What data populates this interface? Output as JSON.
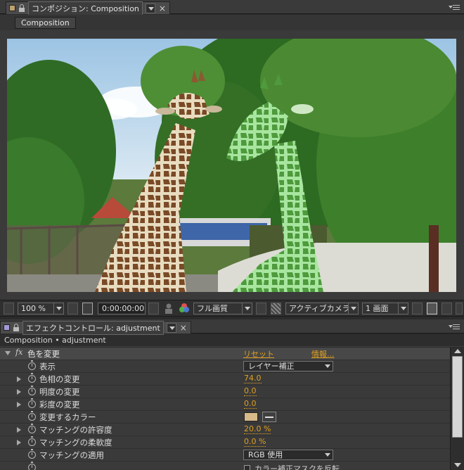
{
  "comp_panel": {
    "tab_title": "コンポジション: Composition",
    "comp_button": "Composition"
  },
  "viewer_toolbar": {
    "zoom": "100 %",
    "timecode": "0:00:00:00",
    "resolution": "フル画質",
    "camera": "アクティブカメラ",
    "views": "1 画面"
  },
  "effects_panel": {
    "tab_title": "エフェクトコントロール: adjustment",
    "breadcrumb": "Composition • adjustment",
    "effect": {
      "fx_label": "fx",
      "name": "色を変更",
      "reset_label": "リセット",
      "about_label": "情報..."
    },
    "params": [
      {
        "label": "表示",
        "value": "レイヤー補正"
      },
      {
        "label": "色相の変更",
        "value": "74.0"
      },
      {
        "label": "明度の変更",
        "value": "0.0"
      },
      {
        "label": "彩度の変更",
        "value": "0.0"
      },
      {
        "label": "変更するカラー",
        "color": "#d8b98a"
      },
      {
        "label": "マッチングの許容度",
        "value": "20.0 %"
      },
      {
        "label": "マッチングの柔軟度",
        "value": "0.0 %"
      },
      {
        "label": "マッチングの適用",
        "value": "RGB 使用"
      },
      {
        "label": "",
        "value": "カラー補正マスクを反転"
      }
    ]
  },
  "colors": {
    "accent": "#e0a020",
    "panel_bg": "#3a3a3a"
  }
}
